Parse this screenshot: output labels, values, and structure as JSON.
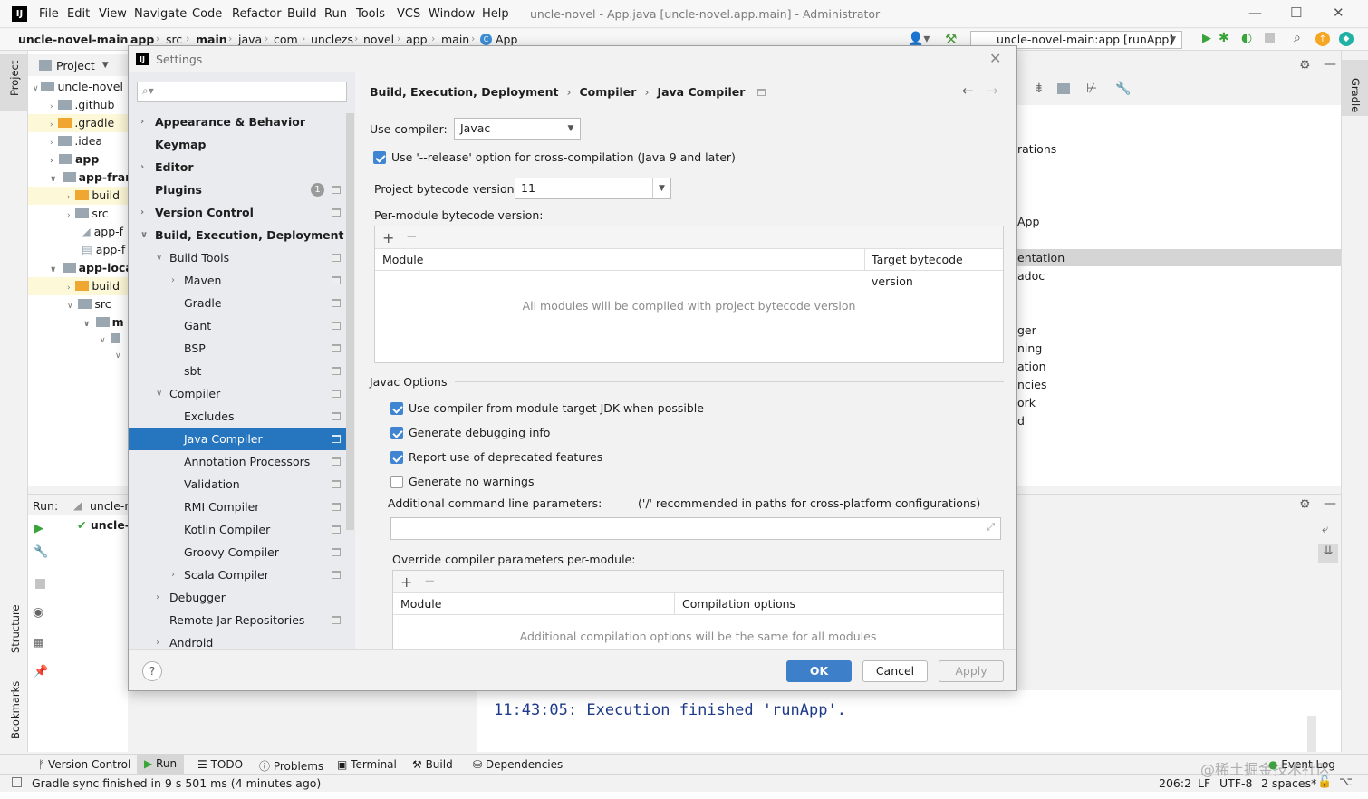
{
  "menubar": {
    "items": [
      "File",
      "Edit",
      "View",
      "Navigate",
      "Code",
      "Refactor",
      "Build",
      "Run",
      "Tools",
      "VCS",
      "Window",
      "Help"
    ],
    "title": "uncle-novel - App.java [uncle-novel.app.main] - Administrator"
  },
  "navbar": {
    "crumbs": [
      "uncle-novel-main",
      "app",
      "src",
      "main",
      "java",
      "com",
      "unclezs",
      "novel",
      "app",
      "main",
      "App"
    ],
    "run_config": "uncle-novel-main:app [runApp]"
  },
  "project": {
    "header": "Project",
    "items": [
      {
        "label": "uncle-novel"
      },
      {
        "label": ".github"
      },
      {
        "label": ".gradle"
      },
      {
        "label": ".idea"
      },
      {
        "label": "app"
      },
      {
        "label": "app-fran"
      },
      {
        "label": "build"
      },
      {
        "label": "src"
      },
      {
        "label": "app-f"
      },
      {
        "label": "app-f"
      },
      {
        "label": "app-loca"
      },
      {
        "label": "build"
      },
      {
        "label": "src"
      },
      {
        "label": "m"
      }
    ]
  },
  "left_stripe": {
    "project": "Project",
    "structure": "Structure",
    "bookmarks": "Bookmarks"
  },
  "right_stripe": {
    "gradle": "Gradle"
  },
  "right_pane": {
    "lines": [
      "rations",
      "App",
      "entation",
      "adoc",
      "ger",
      "ning",
      "ation",
      "ncies",
      "ork",
      "d"
    ]
  },
  "run": {
    "label": "Run:",
    "tab": "uncle-n",
    "task": "uncle-"
  },
  "console": {
    "output": "11:43:05: Execution finished 'runApp'."
  },
  "bottom_tools": [
    "Version Control",
    "Run",
    "TODO",
    "Problems",
    "Terminal",
    "Build",
    "Dependencies"
  ],
  "status": {
    "message": "Gradle sync finished in 9 s 501 ms (4 minutes ago)",
    "position": "206:2",
    "line_sep": "LF",
    "encoding": "UTF-8",
    "indent": "2 spaces*",
    "event_log": "Event Log"
  },
  "dialog": {
    "title": "Settings",
    "search_placeholder": "",
    "breadcrumb": [
      "Build, Execution, Deployment",
      "Compiler",
      "Java Compiler"
    ],
    "nav": [
      {
        "label": "Appearance & Behavior"
      },
      {
        "label": "Keymap"
      },
      {
        "label": "Editor"
      },
      {
        "label": "Plugins",
        "badge": "1"
      },
      {
        "label": "Version Control"
      },
      {
        "label": "Build, Execution, Deployment"
      },
      {
        "label": "Build Tools"
      },
      {
        "label": "Maven"
      },
      {
        "label": "Gradle"
      },
      {
        "label": "Gant"
      },
      {
        "label": "BSP"
      },
      {
        "label": "sbt"
      },
      {
        "label": "Compiler"
      },
      {
        "label": "Excludes"
      },
      {
        "label": "Java Compiler"
      },
      {
        "label": "Annotation Processors"
      },
      {
        "label": "Validation"
      },
      {
        "label": "RMI Compiler"
      },
      {
        "label": "Kotlin Compiler"
      },
      {
        "label": "Groovy Compiler"
      },
      {
        "label": "Scala Compiler"
      },
      {
        "label": "Debugger"
      },
      {
        "label": "Remote Jar Repositories"
      },
      {
        "label": "Android"
      }
    ],
    "use_compiler_label": "Use compiler:",
    "use_compiler_value": "Javac",
    "release_option": "Use '--release' option for cross-compilation (Java 9 and later)",
    "bytecode_label": "Project bytecode version:",
    "bytecode_value": "11",
    "per_module_label": "Per-module bytecode version:",
    "module_table": {
      "col1": "Module",
      "col2": "Target bytecode version",
      "empty": "All modules will be compiled with project bytecode version"
    },
    "javac_options": "Javac Options",
    "options": [
      {
        "label": "Use compiler from module target JDK when possible",
        "checked": true
      },
      {
        "label": "Generate debugging info",
        "checked": true
      },
      {
        "label": "Report use of deprecated features",
        "checked": true
      },
      {
        "label": "Generate no warnings",
        "checked": false
      }
    ],
    "additional_params_label": "Additional command line parameters:",
    "additional_params_hint": "('/' recommended in paths for cross-platform configurations)",
    "additional_params_value": "",
    "override_label": "Override compiler parameters per-module:",
    "override_table": {
      "col1": "Module",
      "col2": "Compilation options",
      "empty": "Additional compilation options will be the same for all modules"
    },
    "buttons": {
      "ok": "OK",
      "cancel": "Cancel",
      "apply": "Apply"
    },
    "help": "?"
  },
  "watermark": "@稀土掘金技术社区",
  "colors": {
    "selection": "#2675bf",
    "checkbox": "#3f85d2",
    "primary_button": "#3d80c9",
    "console_text": "#1e3a8a"
  }
}
